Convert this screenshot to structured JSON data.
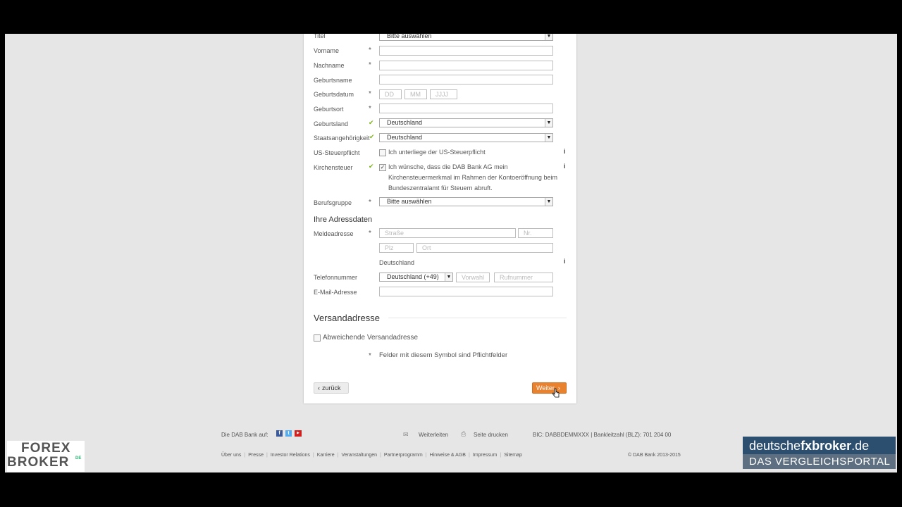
{
  "form": {
    "fields": {
      "titel": {
        "label": "Titel",
        "value": "Bitte auswählen"
      },
      "vorname": {
        "label": "Vorname"
      },
      "nachname": {
        "label": "Nachname"
      },
      "geburtsname": {
        "label": "Geburtsname"
      },
      "geburtsdatum": {
        "label": "Geburtsdatum",
        "dd": "DD",
        "mm": "MM",
        "yyyy": "JJJJ"
      },
      "geburtsort": {
        "label": "Geburtsort"
      },
      "geburtsland": {
        "label": "Geburtsland",
        "value": "Deutschland"
      },
      "staat": {
        "label": "Staatsangehörigkeit",
        "value": "Deutschland"
      },
      "us": {
        "label": "US-Steuerpflicht",
        "text": "Ich unterliege der US-Steuerpflicht"
      },
      "kirche": {
        "label": "Kirchensteuer",
        "text1": "Ich wünsche, dass die DAB Bank AG mein",
        "text2": "Kirchensteuermerkmal im Rahmen der Kontoeröffnung beim",
        "text3": "Bundeszentralamt für Steuern abruft."
      },
      "beruf": {
        "label": "Berufsgruppe",
        "value": "Bitte auswählen"
      }
    },
    "address": {
      "heading": "Ihre Adressdaten",
      "melde": "Meldeadresse",
      "strasse": "Straße",
      "nr": "Nr.",
      "plz": "Plz",
      "ort": "Ort",
      "country": "Deutschland",
      "tel_label": "Telefonnummer",
      "tel_country": "Deutschland (+49)",
      "vorwahl": "Vorwahl",
      "rufnummer": "Rufnummer",
      "email_label": "E-Mail-Adresse"
    },
    "versand": {
      "heading": "Versandadresse",
      "checkbox": "Abweichende Versandadresse"
    },
    "required_note": "Felder mit diesem Symbol sind Pflichtfelder",
    "star": "*",
    "check": "✔",
    "info": "i",
    "back": "zurück",
    "next": "Weiter"
  },
  "footer": {
    "dab_on": "Die DAB Bank auf:",
    "weiterleiten": "Weiterleiten",
    "drucken": "Seite drucken",
    "bic": "BIC: DABBDEMMXXX | Bankleitzahl (BLZ): 701 204 00",
    "links": [
      "Über uns",
      "Presse",
      "Investor Relations",
      "Karriere",
      "Veranstaltungen",
      "Partnerprogramm",
      "Hinweise & AGB",
      "Impressum",
      "Sitemap"
    ],
    "copyright": "© DAB Bank 2013-2015"
  },
  "overlay": {
    "logo_left_1": "FOREX",
    "logo_left_2": "BROKER",
    "logo_left_de": "DE",
    "logo_right_1a": "deutsche",
    "logo_right_1b": "fxbroker",
    "logo_right_1c": ".de",
    "logo_right_2": "DAS VERGLEICHSPORTAL"
  },
  "colors": {
    "accent": "#e8822f",
    "check": "#7ab317",
    "fx_green": "#2bb673",
    "fx_blue": "#2c4f6f"
  }
}
